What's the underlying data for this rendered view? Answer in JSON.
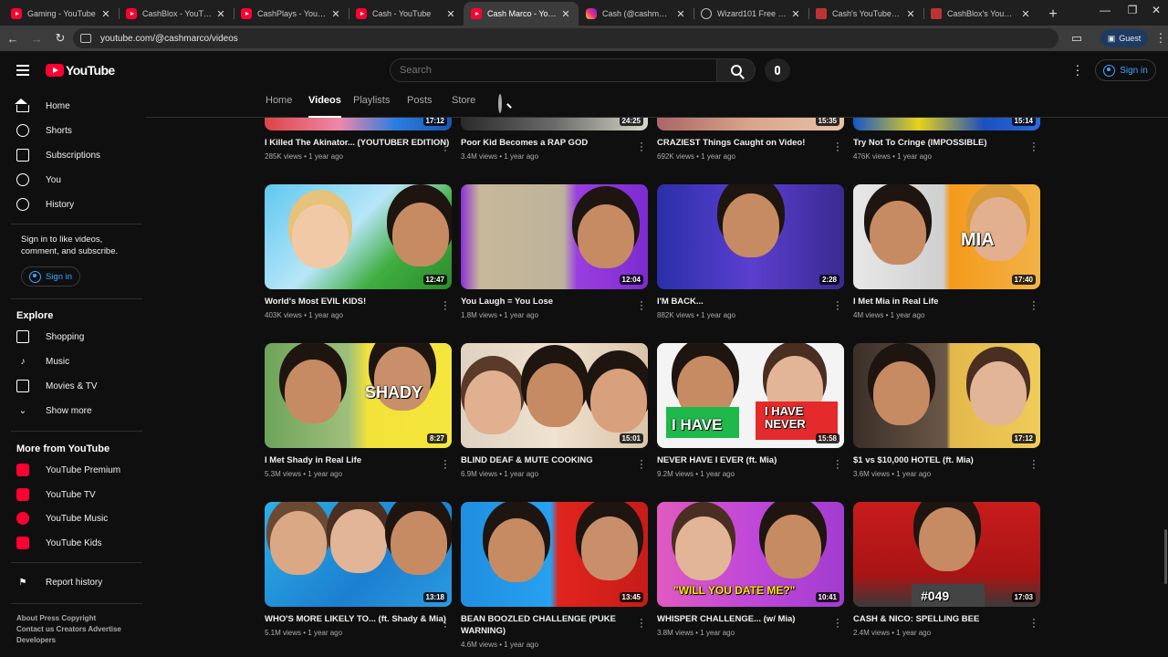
{
  "browser": {
    "tabs": [
      {
        "title": "Gaming - YouTube",
        "favicon": "youtube-icon"
      },
      {
        "title": "CashBlox - YouTube",
        "favicon": "youtube-icon"
      },
      {
        "title": "CashPlays - YouTube",
        "favicon": "youtube-icon"
      },
      {
        "title": "Cash - YouTube",
        "favicon": "youtube-icon"
      },
      {
        "title": "Cash Marco - YouTube",
        "favicon": "youtube-icon",
        "active": true
      },
      {
        "title": "Cash (@cashmarcoyt)",
        "favicon": "instagram-icon"
      },
      {
        "title": "Wizard101 Free Online",
        "favicon": "globe-icon"
      },
      {
        "title": "Cash's YouTube Stats",
        "favicon": "chart-icon"
      },
      {
        "title": "CashBlox's YouTube Stats",
        "favicon": "chart-icon"
      }
    ],
    "url": "youtube.com/@cashmarco/videos",
    "profile_label": "Guest"
  },
  "youtube": {
    "logo_text": "YouTube",
    "search_placeholder": "Search",
    "signin_label": "Sign in"
  },
  "sidebar": {
    "main": [
      {
        "label": "Home",
        "icon": "home-icon"
      },
      {
        "label": "Shorts",
        "icon": "shorts-icon"
      },
      {
        "label": "Subscriptions",
        "icon": "subscriptions-icon"
      },
      {
        "label": "You",
        "icon": "you-icon"
      },
      {
        "label": "History",
        "icon": "history-icon"
      }
    ],
    "signin_note": "Sign in to like videos, comment, and subscribe.",
    "signin_button": "Sign in",
    "explore_heading": "Explore",
    "explore": [
      {
        "label": "Shopping",
        "icon": "shopping-icon"
      },
      {
        "label": "Music",
        "icon": "music-icon"
      },
      {
        "label": "Movies & TV",
        "icon": "movies-icon"
      },
      {
        "label": "Show more",
        "icon": "chevron-down-icon"
      }
    ],
    "more_heading": "More from YouTube",
    "more": [
      {
        "label": "YouTube Premium"
      },
      {
        "label": "YouTube TV"
      },
      {
        "label": "YouTube Music"
      },
      {
        "label": "YouTube Kids"
      }
    ],
    "report_history": "Report history",
    "footer_line1": "About  Press  Copyright",
    "footer_line2": "Contact us  Creators  Advertise",
    "footer_line3": "Developers"
  },
  "channel_tabs": [
    "Home",
    "Videos",
    "Playlists",
    "Posts",
    "Store"
  ],
  "active_channel_tab": "Videos",
  "videos": [
    {
      "title": "I Killed The Akinator... (YOUTUBER EDITION)",
      "views": "285K views",
      "age": "1 year ago",
      "duration": "17:12",
      "overlay": ""
    },
    {
      "title": "Poor Kid Becomes a RAP GOD",
      "views": "3.4M views",
      "age": "1 year ago",
      "duration": "24:25",
      "overlay": ""
    },
    {
      "title": "CRAZIEST Things Caught on Video!",
      "views": "692K views",
      "age": "1 year ago",
      "duration": "15:35",
      "overlay": ""
    },
    {
      "title": "Try Not To Cringe (IMPOSSIBLE)",
      "views": "476K views",
      "age": "1 year ago",
      "duration": "15:14",
      "overlay": ""
    },
    {
      "title": "World's Most EVIL KIDS!",
      "views": "403K views",
      "age": "1 year ago",
      "duration": "12:47",
      "overlay": ""
    },
    {
      "title": "You Laugh = You Lose",
      "views": "1.8M views",
      "age": "1 year ago",
      "duration": "12:04",
      "overlay": ""
    },
    {
      "title": "I'M BACK...",
      "views": "882K views",
      "age": "1 year ago",
      "duration": "2:28",
      "overlay": ""
    },
    {
      "title": "I Met Mia in Real Life",
      "views": "4M views",
      "age": "1 year ago",
      "duration": "17:40",
      "overlay": "MIA"
    },
    {
      "title": "I Met Shady in Real Life",
      "views": "5.3M views",
      "age": "1 year ago",
      "duration": "8:27",
      "overlay": "SHADY"
    },
    {
      "title": "BLIND DEAF & MUTE COOKING",
      "views": "6.9M views",
      "age": "1 year ago",
      "duration": "15:01",
      "overlay": ""
    },
    {
      "title": "NEVER HAVE I EVER (ft. Mia)",
      "views": "9.2M views",
      "age": "1 year ago",
      "duration": "15:58",
      "overlay": "I HAVE",
      "overlay2": "I HAVE NEVER"
    },
    {
      "title": "$1 vs $10,000 HOTEL (ft. Mia)",
      "views": "3.6M views",
      "age": "1 year ago",
      "duration": "17:12",
      "overlay": ""
    },
    {
      "title": "WHO'S MORE LIKELY TO... (ft. Shady & Mia)",
      "views": "5.1M views",
      "age": "1 year ago",
      "duration": "13:18",
      "overlay": ""
    },
    {
      "title": "BEAN BOOZLED CHALLENGE (PUKE WARNING)",
      "views": "4.6M views",
      "age": "1 year ago",
      "duration": "13:45",
      "overlay": ""
    },
    {
      "title": "WHISPER CHALLENGE... (w/ Mia)",
      "views": "3.8M views",
      "age": "1 year ago",
      "duration": "10:41",
      "overlay": "\"WILL YOU DATE ME?\""
    },
    {
      "title": "CASH & NICO: SPELLING BEE",
      "views": "2.4M views",
      "age": "1 year ago",
      "duration": "17:03",
      "overlay": "#049"
    }
  ],
  "colors": {
    "background": "#0f0f0f",
    "youtube_red": "#ff0033",
    "link_blue": "#3ea6ff"
  }
}
